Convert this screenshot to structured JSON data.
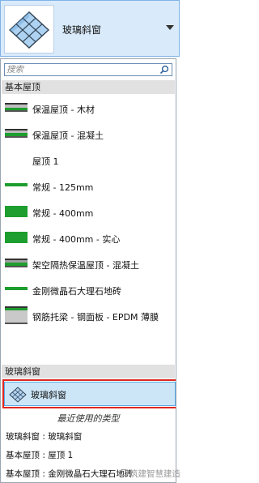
{
  "header": {
    "icon": "glazed-roof-icon",
    "type_name": "玻璃斜窗",
    "dropdown_icon": "chevron-down-icon"
  },
  "search": {
    "placeholder": "搜索",
    "icon": "search-icon"
  },
  "groups": [
    {
      "name": "基本屋顶",
      "items": [
        {
          "label": "保温屋顶 - 木材",
          "swatch": "layered-gray"
        },
        {
          "label": "保温屋顶 - 混凝土",
          "swatch": "layered-gray"
        },
        {
          "label": "屋顶 1",
          "swatch": "none"
        },
        {
          "label": "常规 - 125mm",
          "swatch": "thin-green"
        },
        {
          "label": "常规 - 400mm",
          "swatch": "thick-green"
        },
        {
          "label": "常规 - 400mm - 实心",
          "swatch": "thick-green"
        },
        {
          "label": "架空隔热保温屋顶 - 混凝土",
          "swatch": "layered-gray"
        },
        {
          "label": "金刚微晶石大理石地砖",
          "swatch": "thin-green"
        },
        {
          "label": "钢筋托梁 - 钢面板 - EPDM 薄膜",
          "swatch": "layered-gray-tall"
        }
      ]
    },
    {
      "name": "玻璃斜窗",
      "items": [
        {
          "label": "玻璃斜窗",
          "swatch": "glazed-roof-icon",
          "selected": true
        }
      ]
    }
  ],
  "recent": {
    "header": "最近使用的类型",
    "items": [
      "玻璃斜窗 : 玻璃斜窗",
      "基本屋顶 : 屋顶 1",
      "基本屋顶 : 金刚微晶石大理石地砖"
    ]
  },
  "watermark": "筑建智慧建造",
  "colors": {
    "header_bg": "#d9ebfb",
    "selected_bg": "#cde6f7",
    "highlight_border": "#e0271f",
    "material_green": "#1e9e2e",
    "group_header_bg": "#e1e1e1"
  }
}
